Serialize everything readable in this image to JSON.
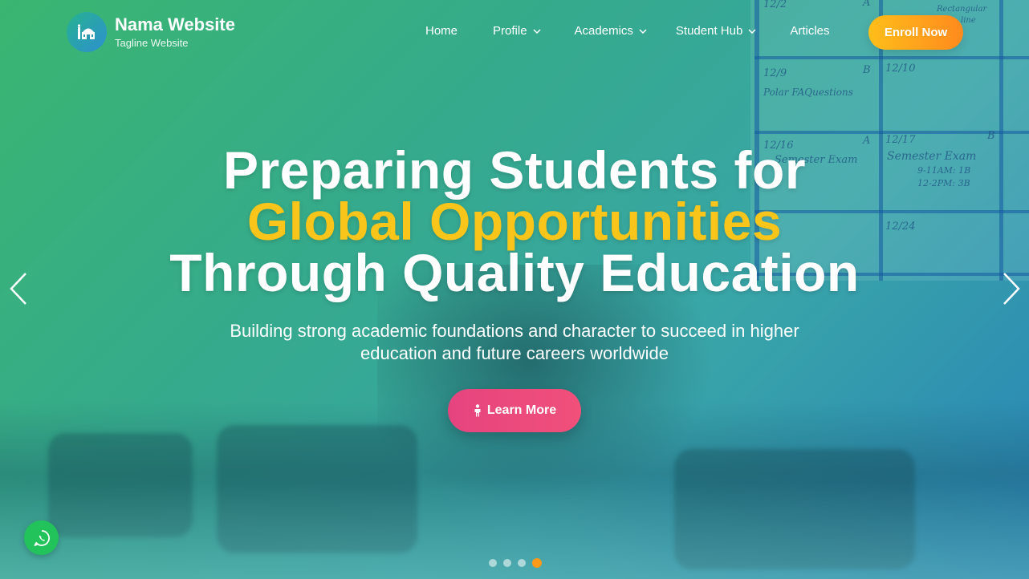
{
  "brand": {
    "name": "Nama Website",
    "tagline": "Tagline Website",
    "logo_icon": "mosque-icon"
  },
  "nav": {
    "items": [
      {
        "label": "Home",
        "has_dropdown": false
      },
      {
        "label": "Profile",
        "has_dropdown": true
      },
      {
        "label": "Academics",
        "has_dropdown": true
      },
      {
        "label": "Student Hub",
        "has_dropdown": true
      },
      {
        "label": "Articles",
        "has_dropdown": false
      }
    ],
    "cta": "Enroll Now"
  },
  "hero": {
    "line1": "Preparing Students for",
    "line2": "Global Opportunities",
    "line3": "Through Quality Education",
    "subtitle": "Building strong academic foundations and character to succeed in higher education and future careers worldwide",
    "button": "Learn More",
    "button_icon": "person-icon"
  },
  "board": {
    "cells": [
      "12/2",
      "12/9",
      "Polar FAQuestions",
      "12/10",
      "12/16",
      "Semester Exam",
      "12/17",
      "Semester Exam",
      "9-11AM: 1B",
      "12-2PM: 3B",
      "12/24",
      "A",
      "B",
      "A",
      "B",
      "Rectangular",
      "line"
    ]
  },
  "carousel": {
    "slide_count": 4,
    "active_slide": 4
  },
  "colors": {
    "accent_yellow": "#f9c51a",
    "cta_orange": "#ff8a1e",
    "button_pink": "#e6447f",
    "whatsapp_green": "#23c35c"
  }
}
